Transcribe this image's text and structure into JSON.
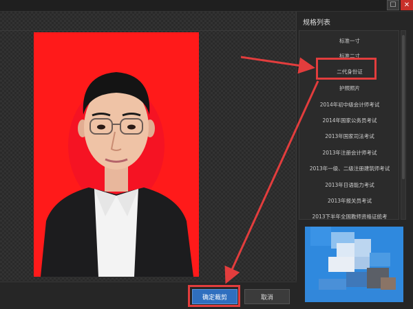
{
  "window": {
    "restore_icon": "restore-icon",
    "close_icon": "close-icon"
  },
  "panel": {
    "title": "规格列表",
    "specs": [
      "标准一寸",
      "标准二寸",
      "二代身份证",
      "护照照片",
      "2014年初中级会计师考试",
      "2014年国家公务员考试",
      "2013年国家司法考试",
      "2013年注册会计师考试",
      "2013年一级、二级注册建筑师考试",
      "2013年日语能力考试",
      "2013年报关员考试",
      "2013下半年全国教师资格证统考"
    ],
    "selected_spec": "二代身份证"
  },
  "actions": {
    "confirm": "确定裁剪",
    "cancel": "取消"
  },
  "colors": {
    "photo_background": "#ff1a1a",
    "confirm_button": "#2f6fbf",
    "annotation": "#e23d3d",
    "preview": "#2e8adf"
  }
}
